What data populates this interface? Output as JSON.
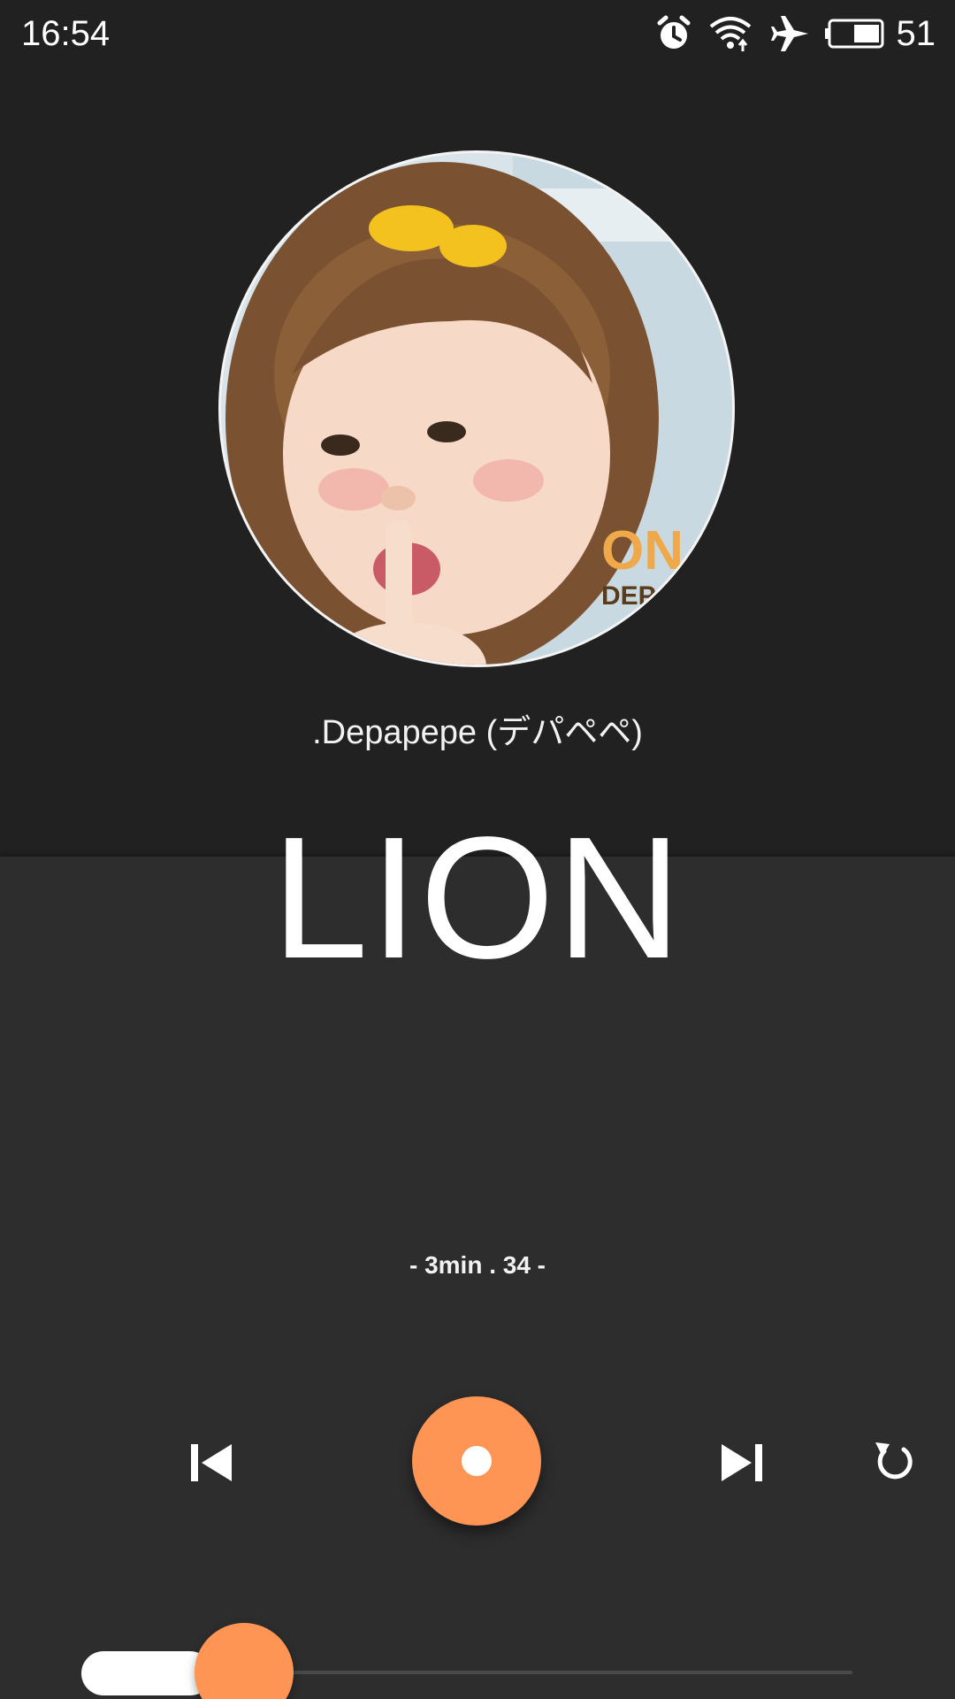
{
  "status_bar": {
    "time": "16:54",
    "battery_level": "51",
    "icons": [
      "alarm-icon",
      "wifi-icon",
      "airplane-mode-icon",
      "battery-icon"
    ]
  },
  "player": {
    "artist": ".Depapepe (デパペペ)",
    "title": "LION",
    "duration": "- 3min . 34 -",
    "progress_fraction": 0.17,
    "controls": [
      "previous-track-icon",
      "play-button",
      "next-track-icon",
      "replay-icon"
    ]
  },
  "colors": {
    "background_top": "#212121",
    "background_bottom": "#2d2d2d",
    "accent": "#ff9554",
    "text": "#ffffff"
  }
}
